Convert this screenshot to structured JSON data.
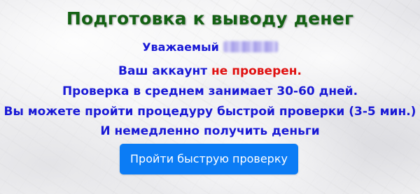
{
  "page": {
    "title": "Подготовка к выводу денег",
    "greeting_prefix": "Уважаемый",
    "account_text": "Ваш аккаунт",
    "account_status": "не проверен.",
    "verification_time": "Проверка в среднем занимает 30-60 дней.",
    "quick_check_offer": "Вы можете пройти процедуру быстрой проверки (3-5 мин.)",
    "instant_money": "И немедленно получить деньги",
    "button_label": "Пройти быструю проверку"
  },
  "colors": {
    "title": "#146214",
    "body_text": "#1a1ad6",
    "status_alert": "#e01010",
    "button_bg": "#0b7cf5",
    "button_text": "#ffffff"
  }
}
